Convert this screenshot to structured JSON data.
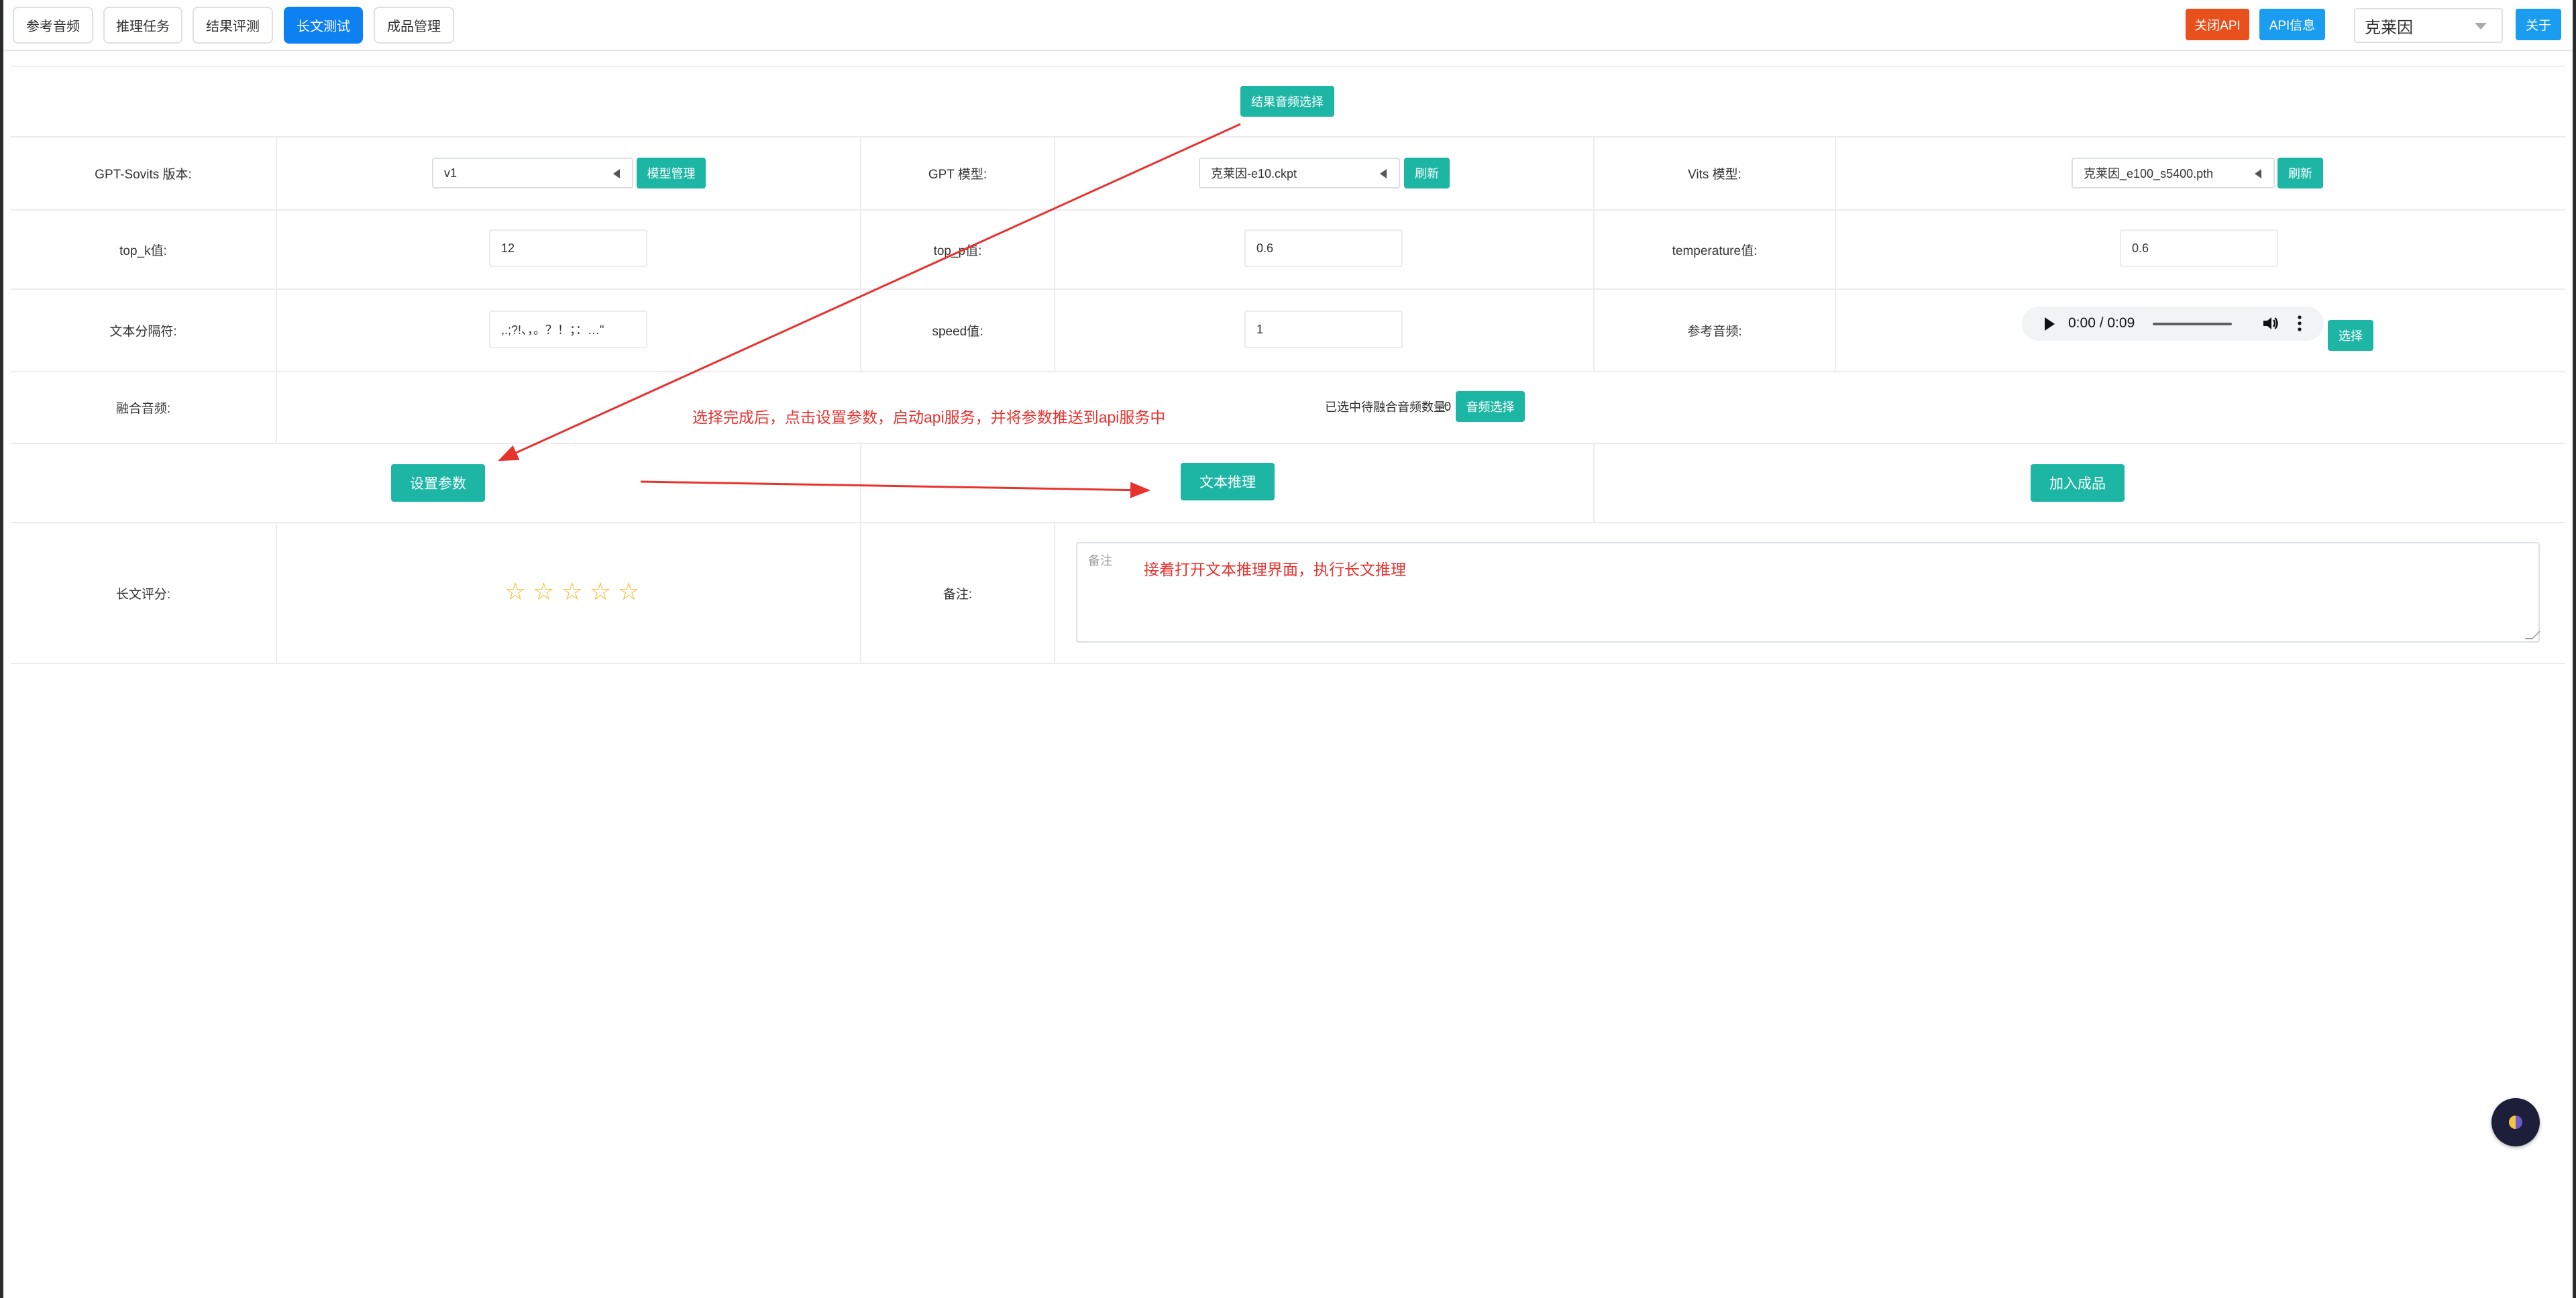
{
  "nav": {
    "tabs": [
      {
        "label": "参考音频"
      },
      {
        "label": "推理任务"
      },
      {
        "label": "结果评测"
      },
      {
        "label": "长文测试",
        "active": true
      },
      {
        "label": "成品管理"
      }
    ],
    "close_api": "关闭API",
    "api_info": "API信息",
    "role": "克莱因",
    "about": "关于"
  },
  "result_audio_select": "结果音频选择",
  "rows": {
    "version_label": "GPT-Sovits 版本:",
    "version_value": "v1",
    "model_manage": "模型管理",
    "gpt_label": "GPT 模型:",
    "gpt_value": "克莱因-e10.ckpt",
    "refresh": "刷新",
    "vits_label": "Vits 模型:",
    "vits_value": "克莱因_e100_s5400.pth",
    "topk_label": "top_k值:",
    "topk_value": "12",
    "topp_label": "top_p值:",
    "topp_value": "0.6",
    "temp_label": "temperature值:",
    "temp_value": "0.6",
    "sep_label": "文本分隔符:",
    "sep_value": ",.;?!、，。？！；：…\"",
    "speed_label": "speed值:",
    "speed_value": "1",
    "ref_label": "参考音频:",
    "audio_time": "0:00 / 0:09",
    "choose": "选择",
    "mix_label": "融合音频:",
    "mix_count_label": "已选中待融合音频数量:",
    "mix_count": "0",
    "audio_choose": "音频选择",
    "set_params": "设置参数",
    "text_infer": "文本推理",
    "add_product": "加入成品",
    "score_label": "长文评分:",
    "remark_label": "备注:",
    "remark_placeholder": "备注"
  },
  "rating": {
    "value": 0,
    "max": 5
  },
  "annotations": {
    "first": "选择完成后，点击设置参数，启动api服务，并将参数推送到api服务中",
    "second": "接着打开文本推理界面，执行长文推理"
  },
  "colors": {
    "teal": "#1db6a5",
    "active_tab": "#0d80f2",
    "danger": "#e8501c",
    "info": "#1a9cf0",
    "annotation": "#e8322e",
    "star": "#f7ba2a"
  }
}
